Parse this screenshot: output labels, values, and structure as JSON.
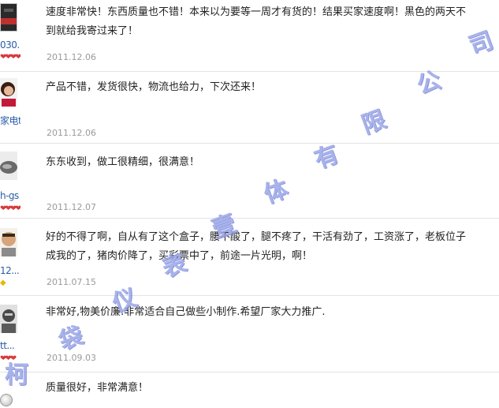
{
  "reviews": [
    {
      "user": "030...",
      "rank": "❤❤❤❤",
      "rank_color": "#d63a3a",
      "text": "速度非常快！东西质量也不错！本来以为要等一周才有货的！结果买家速度啊！黑色的两天不\n到就给我寄过来了！",
      "date": "2011.12.06",
      "avatar_icon": "dark-photo-avatar"
    },
    {
      "user": "家电t...",
      "rank": "",
      "text": "产品不错，发货很快，物流也给力，下次还来！",
      "date": "2011.12.06",
      "avatar_icon": "woman-photo-avatar"
    },
    {
      "user": "h-gs",
      "rank": "❤❤❤❤",
      "rank_color": "#d63a3a",
      "text": "东东收到，做工很精细，很满意！",
      "date": "2011.12.07",
      "avatar_icon": "grey-object-avatar"
    },
    {
      "user": "12...",
      "rank": "◆",
      "rank_color": "#e6b800",
      "text": "好的不得了啊，自从有了这个盒子，腰不酸了，腿不疼了，干活有劲了，工资涨了，老板位子\n成我的了，猪肉价降了，买彩票中了，前途一片光明，啊！",
      "date": "2011.07.15",
      "avatar_icon": "man-photo-avatar"
    },
    {
      "user": "tt...",
      "rank": "❤❤❤",
      "rank_color": "#d63a3a",
      "text": "非常好,物美价廉.非常适合自己做些小制作.希望厂家大力推广.",
      "date": "2011.09.03",
      "avatar_icon": "armor-photo-avatar"
    },
    {
      "user": "",
      "rank": "",
      "text": "质量很好，非常满意！",
      "date": "",
      "avatar_icon": ""
    }
  ],
  "watermark": [
    "柯",
    "袋",
    "仪",
    "表",
    "壹",
    "体",
    "有",
    "限",
    "公",
    "司"
  ]
}
